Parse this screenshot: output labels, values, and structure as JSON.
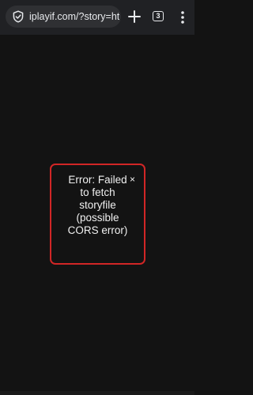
{
  "browser": {
    "url": "iplayif.com/?story=https",
    "tab_count": "3",
    "icons": {
      "site_info": "site-info-icon",
      "new_tab": "plus-icon",
      "tabs": "tab-switcher-icon",
      "menu": "more-vert-icon"
    }
  },
  "dialog": {
    "close_label": "×",
    "message": "Error: Failed to fetch storyfile (possible CORS error)"
  },
  "colors": {
    "background": "#131313",
    "toolbar": "#202124",
    "omnibox": "#2f3033",
    "error_border": "#d12626",
    "text": "#f0f0f0"
  }
}
